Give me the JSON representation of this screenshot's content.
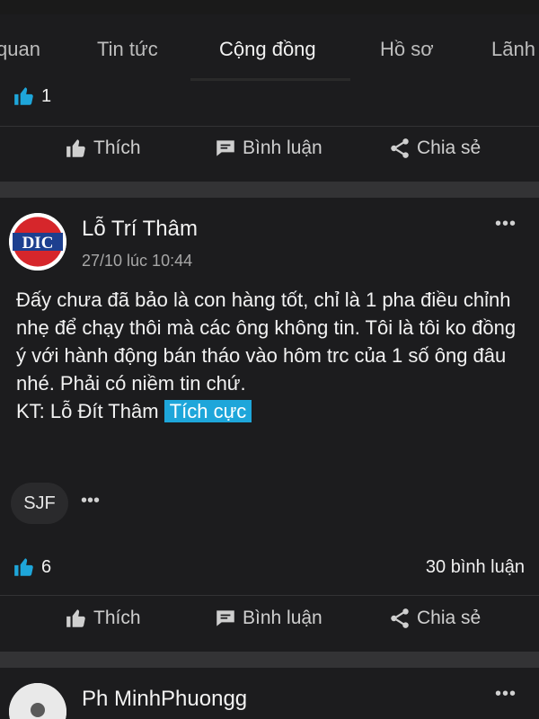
{
  "tabs": [
    "quan",
    "Tin tức",
    "Cộng đồng",
    "Hồ sơ",
    "Lãnh"
  ],
  "active_tab": "Cộng đồng",
  "prev_post": {
    "like_count": "1"
  },
  "actions": {
    "like": "Thích",
    "comment": "Bình luận",
    "share": "Chia sẻ"
  },
  "post": {
    "avatar_text": "DIC",
    "author": "Lỗ Trí Thâm",
    "timestamp": "27/10 lúc 10:44",
    "body": "Đấy chưa đã bảo là con hàng tốt, chỉ là 1 pha điều chỉnh nhẹ để chạy thôi mà các ông không tin. Tôi là tôi ko đồng ý với hành động bán tháo vào hôm trc của 1 số ông đâu nhé. Phải có niềm tin chứ.",
    "signature": "KT: Lỗ Đít Thâm",
    "sentiment": "Tích cực",
    "tag": "SJF",
    "like_count": "6",
    "comment_count": "30 bình luận"
  },
  "next_post": {
    "author": "Ph MinhPhuongg"
  },
  "more_label": "•••",
  "colors": {
    "accent": "#1ea6da",
    "background": "#1c1c1e",
    "separator": "#333335"
  }
}
